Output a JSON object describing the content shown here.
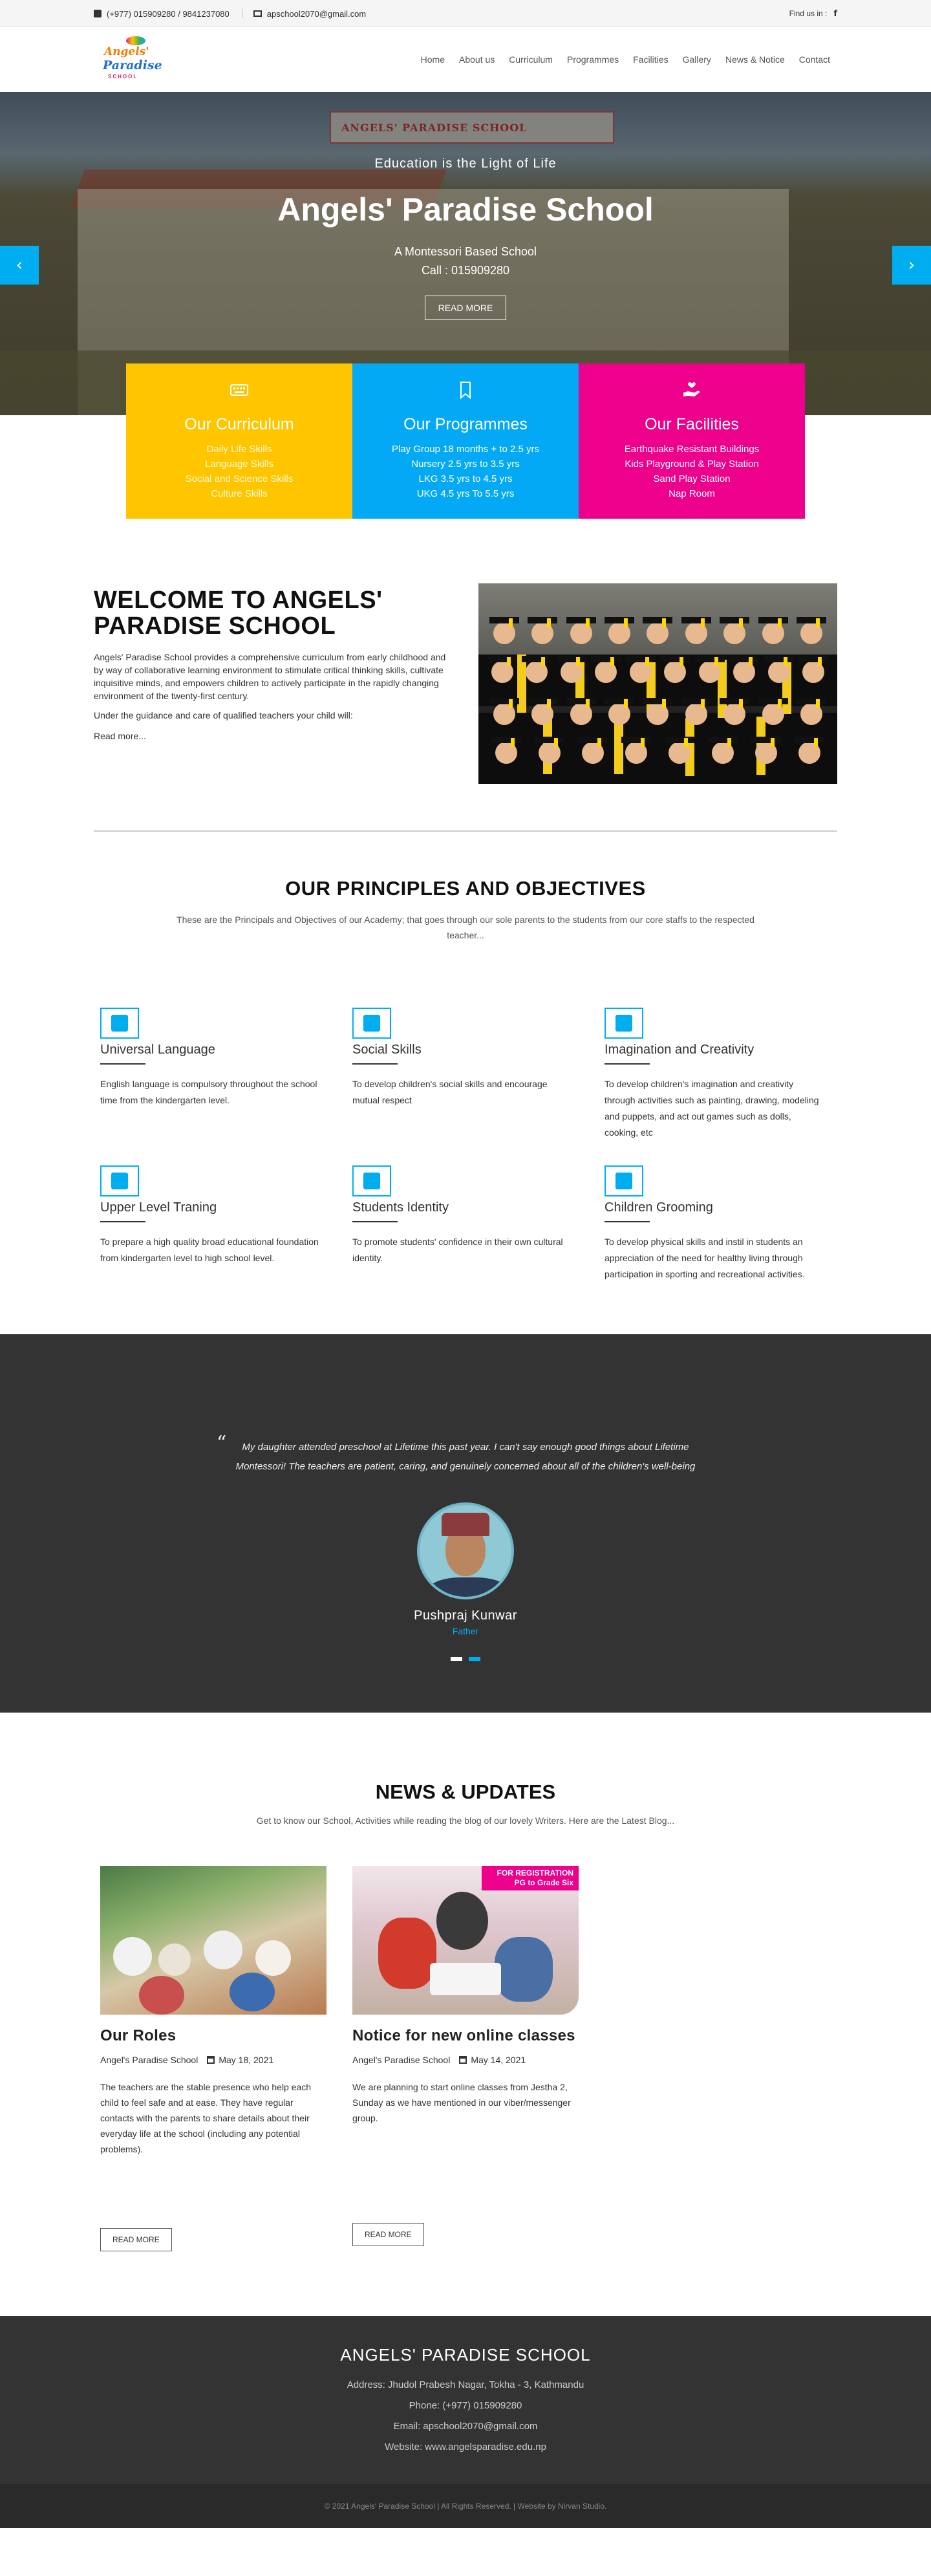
{
  "topbar": {
    "phone": "(+977) 015909280 / 9841237080",
    "email": "apschool2070@gmail.com",
    "find_us": "Find us in :",
    "fb_glyph": "f"
  },
  "logo": {
    "line1": "Angels'",
    "line2": "Paradise",
    "line3": "SCHOOL"
  },
  "nav": [
    "Home",
    "About us",
    "Curriculum",
    "Programmes",
    "Facilities",
    "Gallery",
    "News & Notice",
    "Contact"
  ],
  "hero": {
    "sign": "ANGELS' PARADISE SCHOOL",
    "tagline": "Education is the Light of Life",
    "title": "Angels' Paradise School",
    "subtitle": "A Montessori Based School",
    "call": "Call : 015909280",
    "button": "READ MORE",
    "prev": "‹",
    "next": "›"
  },
  "features": [
    {
      "title": "Our Curriculum",
      "color": "#ffc600",
      "icon": "keyboard-icon",
      "items": [
        "Daily Life Skills",
        "Language Skills",
        "Social and Science Skills",
        "Culture Skills"
      ]
    },
    {
      "title": "Our Programmes",
      "color": "#03a9f4",
      "icon": "bookmark-icon",
      "items": [
        "Play Group 18 months + to 2.5 yrs",
        "Nursery 2.5 yrs to 3.5 yrs",
        "LKG 3.5 yrs to 4.5 yrs",
        "UKG 4.5 yrs To 5.5 yrs"
      ]
    },
    {
      "title": "Our Facilities",
      "color": "#ec008c",
      "icon": "hand-heart-icon",
      "items": [
        "Earthquake Resistant Buildings",
        "Kids Playground & Play Station",
        "Sand Play Station",
        "Nap Room"
      ]
    }
  ],
  "welcome": {
    "title": "WELCOME TO ANGELS' PARADISE SCHOOL",
    "paragraph1": "Angels' Paradise School provides a comprehensive curriculum from early childhood and by way of collaborative learning environment to stimulate critical thinking skills, cultivate inquisitive minds, and empowers children to actively participate in the rapidly changing environment of the twenty-first century.",
    "paragraph2": "Under the guidance and care of qualified teachers your child will:",
    "read_more": "Read more..."
  },
  "principles": {
    "title": "OUR PRINCIPLES AND OBJECTIVES",
    "lead": "These are the Principals and Objectives of our Academy; that goes through our sole parents to the students from our core staffs to the respected teacher...",
    "items": [
      {
        "title": "Universal Language",
        "text": "English language is compulsory throughout the school time from the kindergarten level.",
        "icon": "language-icon"
      },
      {
        "title": "Social Skills",
        "text": "To develop children's social skills and encourage mutual respect",
        "icon": "people-icon"
      },
      {
        "title": "Imagination and Creativity",
        "text": "To develop children's imagination and creativity through activities such as painting, drawing, modeling and puppets, and act out games such as dolls, cooking, etc",
        "icon": "hand-pointer-icon"
      },
      {
        "title": "Upper Level Traning",
        "text": "To prepare a high quality broad educational foundation from kindergarten level to high school level.",
        "icon": "graduate-icon"
      },
      {
        "title": "Students Identity",
        "text": "To promote students' confidence in their own cultural identity.",
        "icon": "id-card-icon"
      },
      {
        "title": "Children Grooming",
        "text": "To develop physical skills and instil in students an appreciation of the need for healthy living through participation in sporting and recreational activities.",
        "icon": "child-icon"
      }
    ]
  },
  "testimonial": {
    "quote_mark": "“",
    "quote": "My daughter attended preschool at Lifetime this past year. I can't say enough good things about Lifetime Montessori! The teachers are patient, caring, and genuinely concerned about all of the children's well-being",
    "name": "Pushpraj Kunwar",
    "role": "Father"
  },
  "news": {
    "title": "NEWS & UPDATES",
    "lead": "Get to know our School, Activities while reading the blog of our lovely Writers. Here are the Latest Blog...",
    "posts": [
      {
        "title": "Our Roles",
        "author": "Angel's Paradise School",
        "date": "May 18, 2021",
        "text": "The teachers are the stable presence who help each child to feel safe and at ease. They have regular contacts with the parents to share details about their everyday life at the school (including any potential problems).",
        "button": "READ MORE"
      },
      {
        "title": "Notice for new online classes",
        "author": "Angel's Paradise School",
        "date": "May 14, 2021",
        "text": "We are planning to start online classes from Jestha 2, Sunday as we have mentioned in our viber/messenger group.",
        "button": "READ MORE",
        "banner1": "FOR REGISTRATION",
        "banner2": "PG to Grade Six"
      }
    ]
  },
  "footer": {
    "title": "ANGELS' PARADISE SCHOOL",
    "address": "Address: Jhudol Prabesh Nagar, Tokha - 3, Kathmandu",
    "phone": "Phone: (+977) 015909280",
    "email": "Email: apschool2070@gmail.com",
    "website": "Website: www.angelsparadise.edu.np",
    "copyright": "© 2021 Angels' Paradise School | All Rights Reserved. | Website by Nirvan Studio."
  },
  "colors": {
    "accent": "#00aeef",
    "yellow": "#ffc600",
    "blue": "#03a9f4",
    "pink": "#ec008c",
    "dark": "#333333"
  }
}
